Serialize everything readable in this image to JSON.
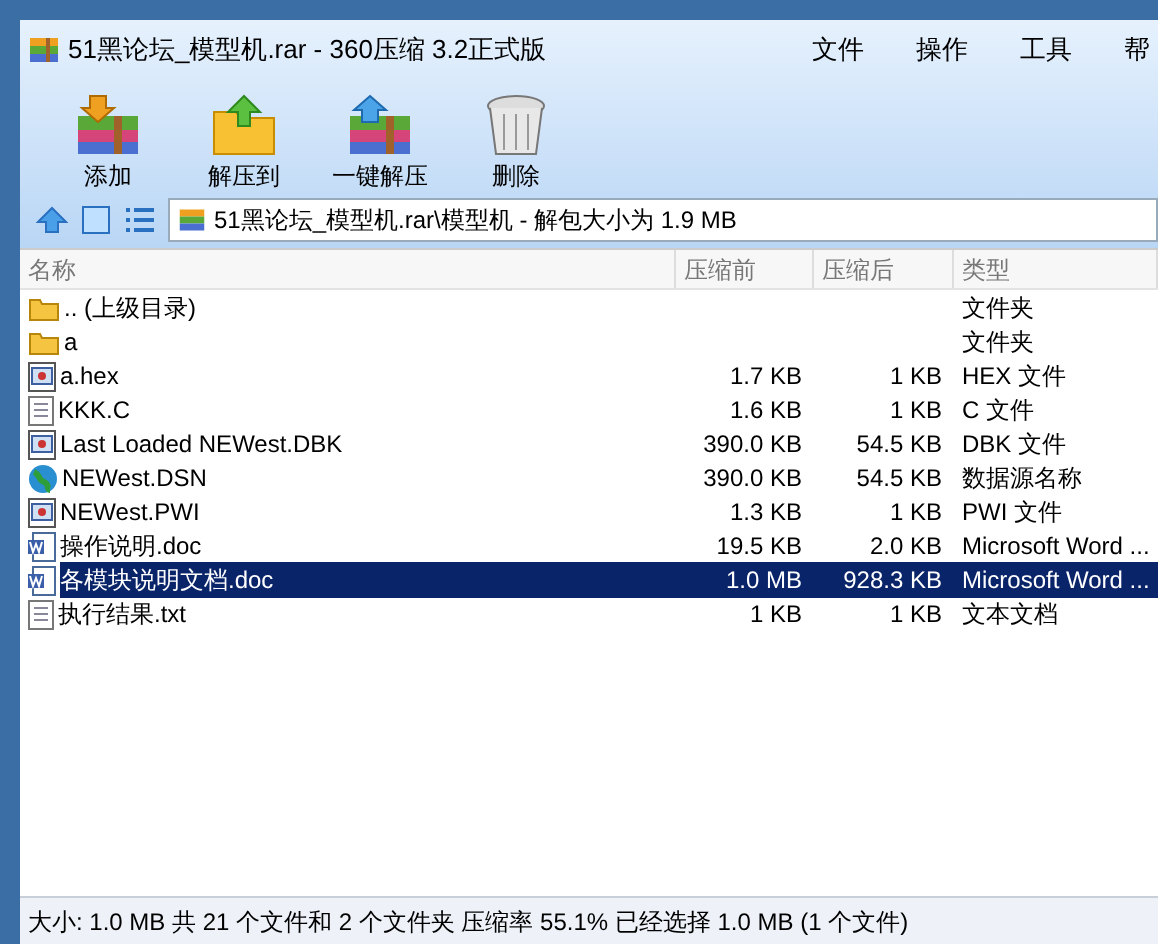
{
  "window": {
    "title": "51黑论坛_模型机.rar - 360压缩 3.2正式版"
  },
  "menu": [
    "文件",
    "操作",
    "工具",
    "帮"
  ],
  "toolbar": [
    {
      "label": "添加",
      "kind": "add"
    },
    {
      "label": "解压到",
      "kind": "extract"
    },
    {
      "label": "一键解压",
      "kind": "oneclick"
    },
    {
      "label": "删除",
      "kind": "delete"
    }
  ],
  "address": "51黑论坛_模型机.rar\\模型机 - 解包大小为 1.9 MB",
  "table": {
    "columns": [
      "名称",
      "压缩前",
      "压缩后",
      "类型"
    ],
    "rows": [
      {
        "kind": "folder",
        "name": ".. (上级目录)",
        "type": "文件夹",
        "selected": false
      },
      {
        "kind": "folder",
        "name": "a",
        "type": "文件夹",
        "selected": false
      },
      {
        "kind": "window",
        "name": "a.hex",
        "before": "1.7 KB",
        "after": "1 KB",
        "type": "HEX 文件",
        "selected": false
      },
      {
        "kind": "text",
        "name": "KKK.C",
        "before": "1.6 KB",
        "after": "1 KB",
        "type": "C 文件",
        "selected": false
      },
      {
        "kind": "window",
        "name": "Last Loaded NEWest.DBK",
        "before": "390.0 KB",
        "after": "54.5 KB",
        "type": "DBK 文件",
        "selected": false
      },
      {
        "kind": "globe",
        "name": "NEWest.DSN",
        "before": "390.0 KB",
        "after": "54.5 KB",
        "type": "数据源名称",
        "selected": false
      },
      {
        "kind": "window",
        "name": "NEWest.PWI",
        "before": "1.3 KB",
        "after": "1 KB",
        "type": "PWI 文件",
        "selected": false
      },
      {
        "kind": "word",
        "name": "操作说明.doc",
        "before": "19.5 KB",
        "after": "2.0 KB",
        "type": "Microsoft Word ...",
        "selected": false
      },
      {
        "kind": "word",
        "name": "各模块说明文档.doc",
        "before": "1.0 MB",
        "after": "928.3 KB",
        "type": "Microsoft Word ...",
        "selected": true
      },
      {
        "kind": "text",
        "name": "执行结果.txt",
        "before": "1 KB",
        "after": "1 KB",
        "type": "文本文档",
        "selected": false
      }
    ]
  },
  "status_bar": "大小: 1.0 MB 共 21 个文件和 2 个文件夹 压缩率 55.1% 已经选择 1.0 MB (1 个文件)"
}
